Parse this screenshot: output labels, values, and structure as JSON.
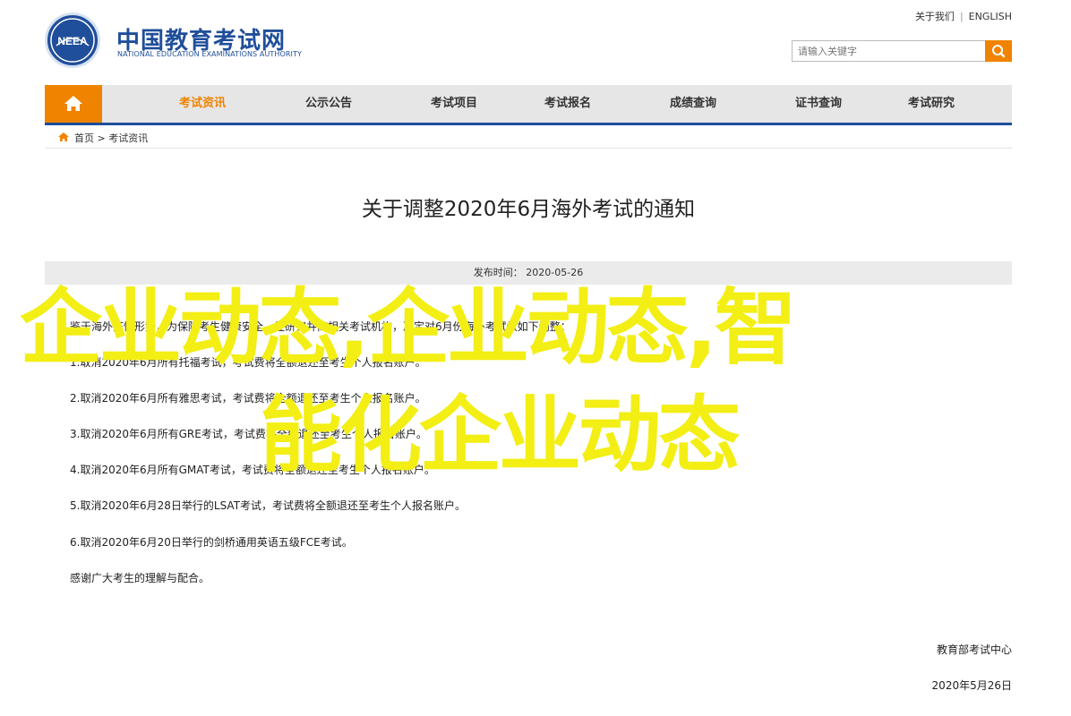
{
  "header": {
    "site_title": "中国教育考试网",
    "site_subtitle": "NATIONAL EDUCATION EXAMINATIONS AUTHORITY",
    "logo_text": "NEEA",
    "links": [
      "关于我们",
      "ENGLISH"
    ],
    "search": {
      "placeholder": "请输入关键字",
      "button_icon": "search-icon"
    },
    "accent": "#f08300",
    "brand": "#1f4e9a"
  },
  "nav": {
    "home_icon": "home-icon",
    "items": [
      "考试资讯",
      "公示公告",
      "考试项目",
      "考试报名",
      "成绩查询",
      "证书查询",
      "考试研究"
    ],
    "active_index": 0
  },
  "breadcrumb": {
    "text": "首页 > 考试资讯"
  },
  "article": {
    "title": "关于调整2020年6月海外考试的通知",
    "meta": "发布时间： 2020-05-26",
    "paragraphs": [
      "鉴于海外疫情形势，为保障考生健康安全，经研究并商相关考试机构，决定对6月份海外考试做如下调整：",
      "1.取消2020年6月所有托福考试，考试费将全额退还至考生个人报名账户。",
      "2.取消2020年6月所有雅思考试，考试费将全额退还至考生个人报名账户。",
      "3.取消2020年6月所有GRE考试，考试费将全额退还至考生个人报名账户。",
      "4.取消2020年6月所有GMAT考试，考试费将全额退还至考生个人报名账户。",
      "5.取消2020年6月28日举行的LSAT考试，考试费将全额退还至考生个人报名账户。",
      "6.取消2020年6月20日举行的剑桥通用英语五级FCE考试。",
      "感谢广大考生的理解与配合。"
    ],
    "signature": "教育部考试中心",
    "date": "2020年5月26日"
  },
  "overlay": {
    "line1": "企业动态,企业动态,智",
    "line2": "能化企业动态",
    "color": "#f3ee14"
  }
}
